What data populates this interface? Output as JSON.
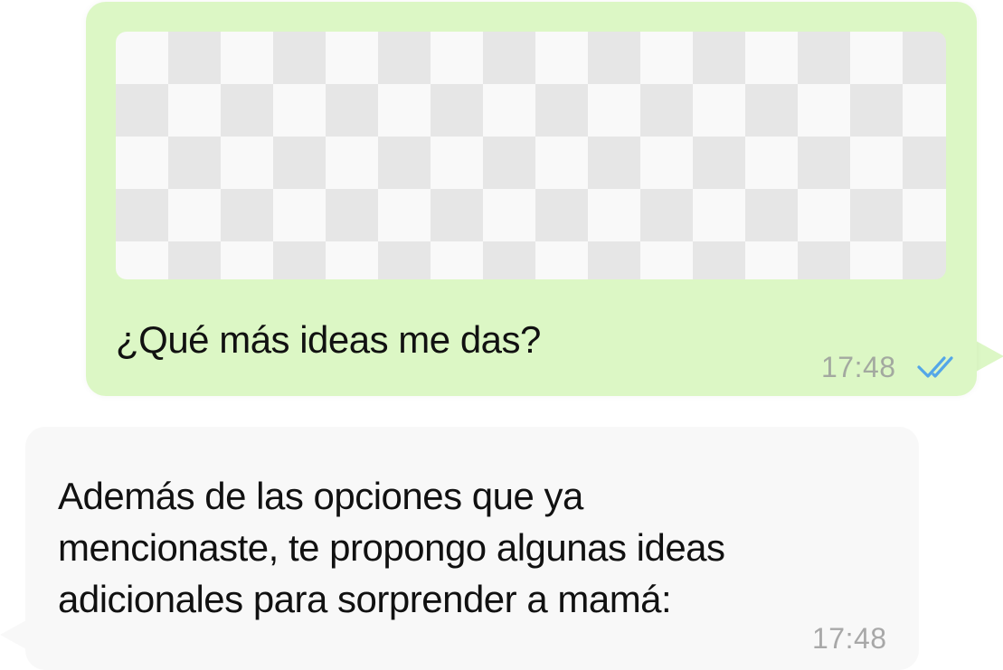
{
  "sent_message": {
    "text": "¿Qué más ideas me das?",
    "time": "17:48",
    "status_icon": "double-check-read-icon",
    "bubble_color": "#dcf7c5",
    "read_color": "#53a6e8",
    "attachment": "image-placeholder"
  },
  "received_message": {
    "lines": [
      "Además de las opciones que ya",
      "mencionaste, te propongo algunas ideas",
      "adicionales para sorprender a mamá:"
    ],
    "time": "17:48",
    "bubble_color": "#f8f8f8"
  }
}
